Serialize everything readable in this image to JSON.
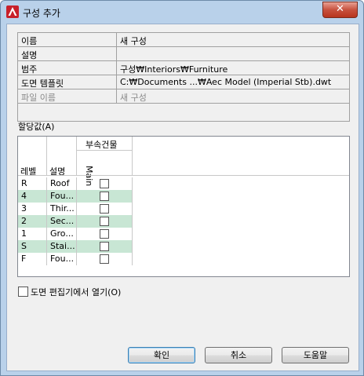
{
  "window": {
    "title": "구성 추가",
    "close_glyph": "✕"
  },
  "properties": [
    {
      "label": "이름",
      "value": "새 구성"
    },
    {
      "label": "설명",
      "value": ""
    },
    {
      "label": "범주",
      "value": "구성₩Interiors₩Furniture"
    },
    {
      "label": "도면 템플릿",
      "value": "C:₩Documents ...₩Aec Model (Imperial Stb).dwt"
    },
    {
      "label": "파일 이름",
      "value": "새 구성",
      "disabled": true
    }
  ],
  "assignments": {
    "label": "할당값(A)",
    "header": {
      "level": "레벨",
      "description": "설명",
      "group": "부속건물",
      "column": "Main"
    },
    "rows": [
      {
        "level": "R",
        "description": "Roof",
        "checked": false
      },
      {
        "level": "4",
        "description": "Fou...",
        "checked": false
      },
      {
        "level": "3",
        "description": "Thir...",
        "checked": false
      },
      {
        "level": "2",
        "description": "Sec...",
        "checked": false
      },
      {
        "level": "1",
        "description": "Gro...",
        "checked": false
      },
      {
        "level": "S",
        "description": "Stai...",
        "checked": false
      },
      {
        "level": "F",
        "description": "Fou...",
        "checked": false
      }
    ]
  },
  "open_in_drawing_editor": {
    "label": "도면 편집기에서 열기(O)",
    "checked": false
  },
  "buttons": {
    "ok": "확인",
    "cancel": "취소",
    "help": "도움말"
  }
}
